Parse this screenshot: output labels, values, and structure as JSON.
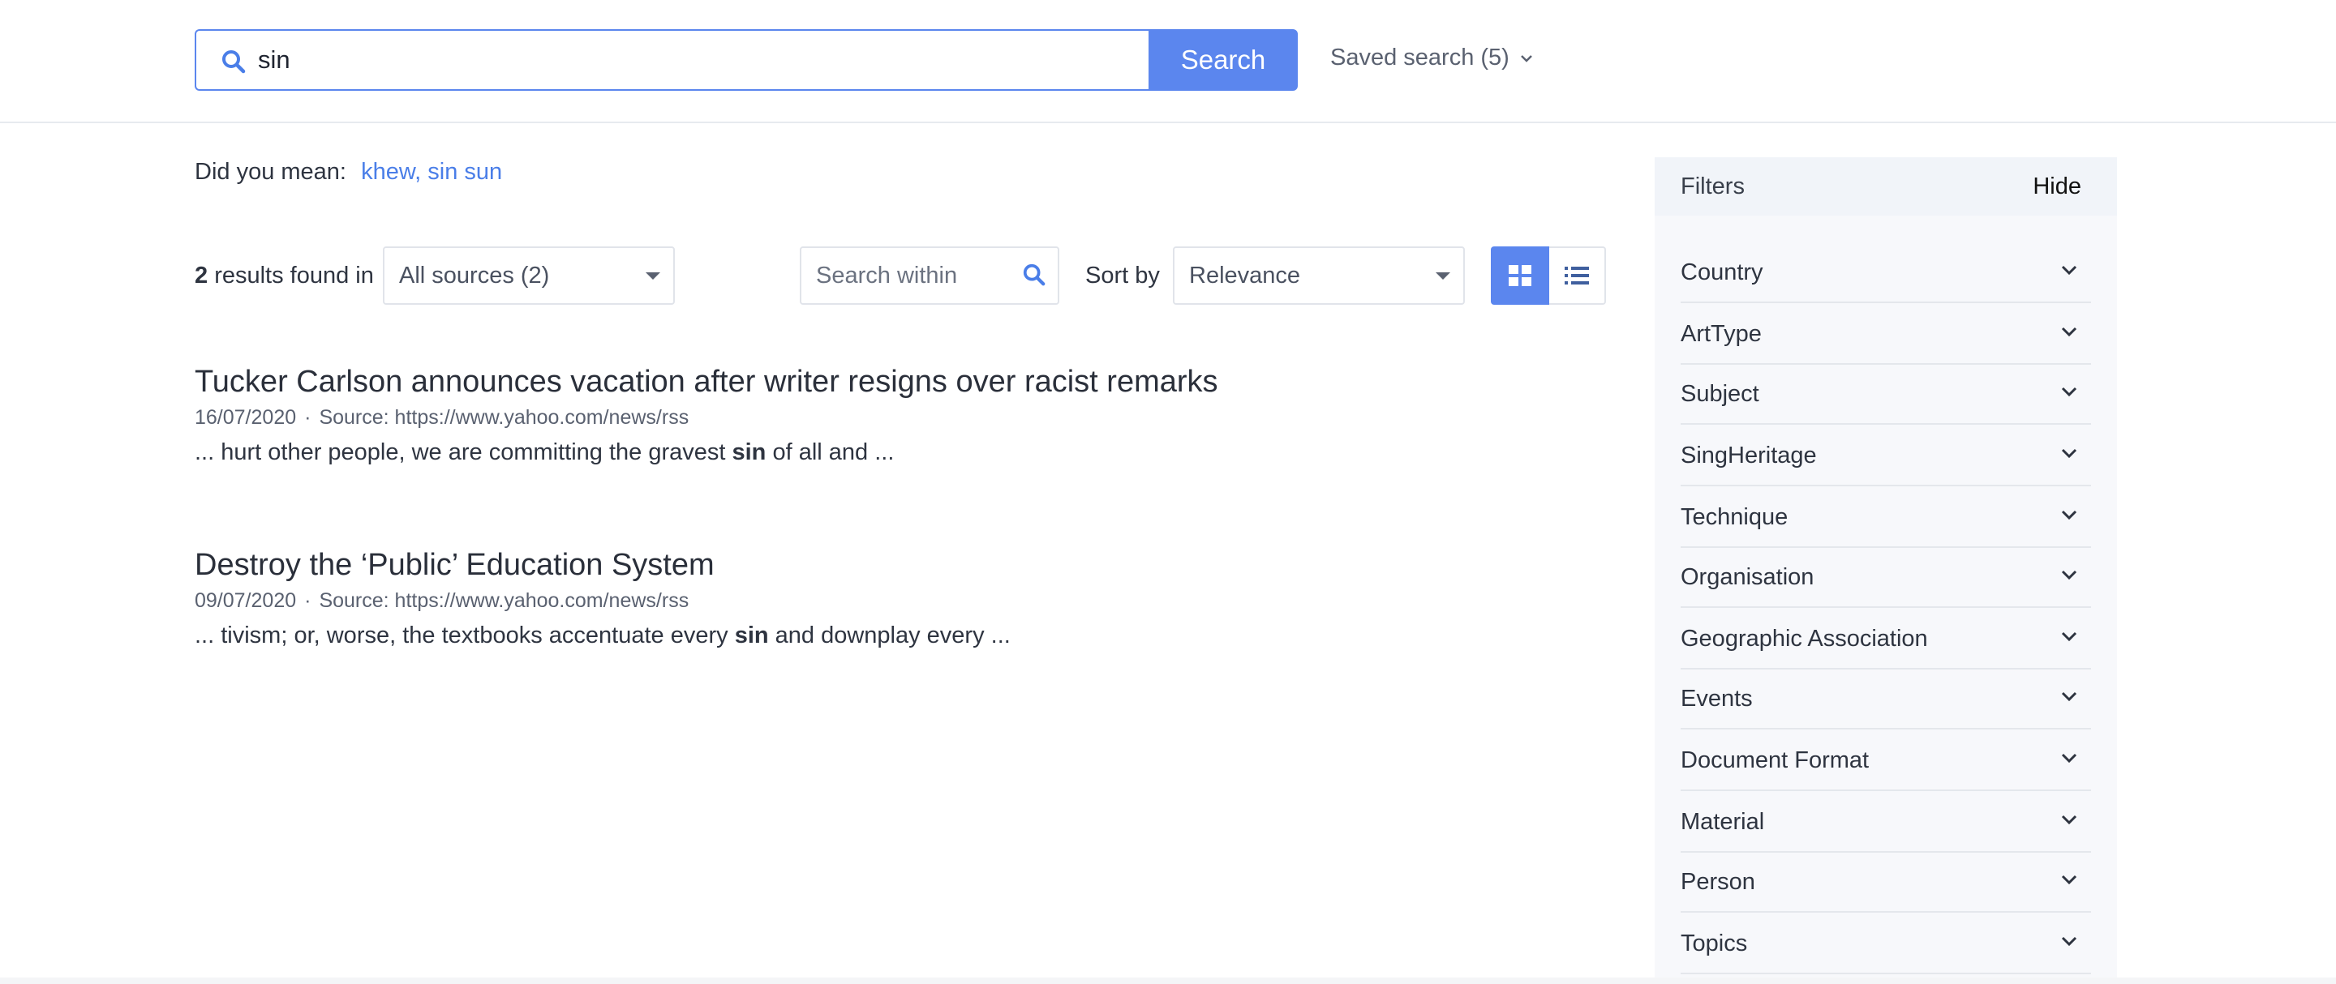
{
  "search": {
    "query": "sin",
    "button_label": "Search",
    "saved_label": "Saved search (5)"
  },
  "did_you_mean": {
    "prefix": "Did you mean:",
    "suggestion": "khew, sin sun"
  },
  "results_bar": {
    "count": "2",
    "count_suffix": "results found in",
    "source_select": "All sources (2)",
    "within_placeholder": "Search within",
    "sort_label": "Sort by",
    "sort_select": "Relevance"
  },
  "results": [
    {
      "title": "Tucker Carlson announces vacation after writer resigns over racist remarks",
      "date": "16/07/2020",
      "source": "Source: https://www.yahoo.com/news/rss",
      "snippet_before": "... hurt other people, we are committing the gravest ",
      "snippet_highlight": "sin",
      "snippet_after": " of all and ..."
    },
    {
      "title": "Destroy the ‘Public’ Education System",
      "date": "09/07/2020",
      "source": "Source: https://www.yahoo.com/news/rss",
      "snippet_before": "... tivism; or, worse, the textbooks accentuate every ",
      "snippet_highlight": "sin",
      "snippet_after": " and downplay every ..."
    }
  ],
  "filters": {
    "title": "Filters",
    "hide_label": "Hide",
    "items": [
      "Country",
      "ArtType",
      "Subject",
      "SingHeritage",
      "Technique",
      "Organisation",
      "Geographic Association",
      "Events",
      "Document Format",
      "Material",
      "Person",
      "Topics"
    ]
  },
  "icons": {
    "search": "search-icon",
    "saved_dropdown": "chevron-down-icon",
    "grid_view": "grid-view-icon",
    "list_view": "list-view-icon",
    "filter_expand": "chevron-down-icon"
  },
  "colors": {
    "accent": "#5b86ee",
    "link": "#4a7ee8",
    "filter_panel": "#f7f8fb"
  }
}
